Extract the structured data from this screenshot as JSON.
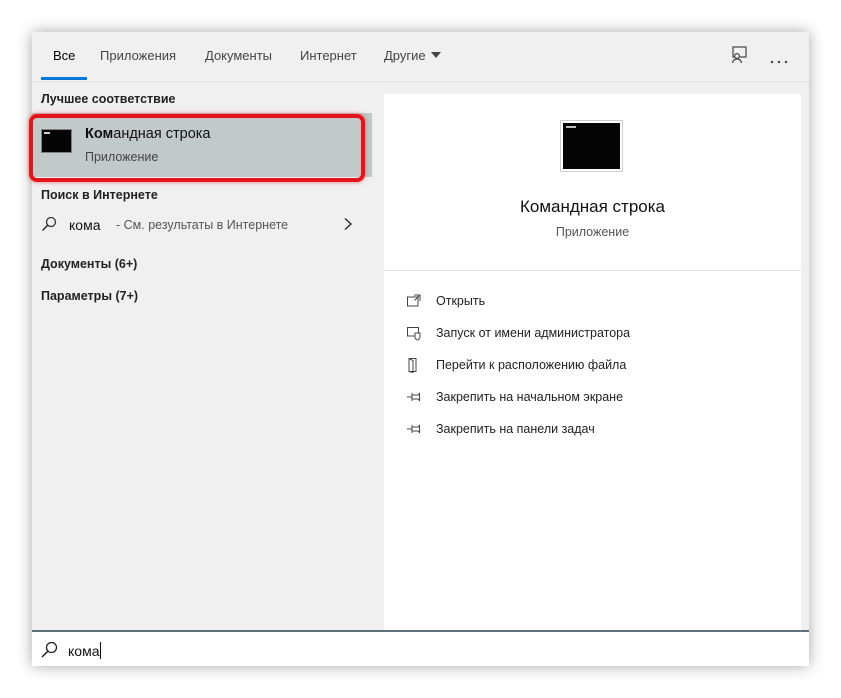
{
  "tabs": [
    {
      "label": "Все"
    },
    {
      "label": "Приложения"
    },
    {
      "label": "Документы"
    },
    {
      "label": "Интернет"
    },
    {
      "label": "Другие"
    }
  ],
  "header_icons": [
    "feedback-icon",
    "more-icon"
  ],
  "left": {
    "best_match_title": "Лучшее соответствие",
    "best_match": {
      "name_bold": "Ком",
      "name_rest": "андная строка",
      "type": "Приложение"
    },
    "web_title": "Поиск в Интернете",
    "web_row": {
      "query": "кома",
      "hint": "- См. результаты в Интернете"
    },
    "documents": "Документы (6+)",
    "settings": "Параметры (7+)"
  },
  "right": {
    "app_name": "Командная строка",
    "app_type": "Приложение",
    "actions": [
      {
        "label": "Открыть",
        "icon": "open-icon"
      },
      {
        "label": "Запуск от имени администратора",
        "icon": "run-as-admin-icon"
      },
      {
        "label": "Перейти к расположению файла",
        "icon": "file-location-icon"
      },
      {
        "label": "Закрепить на начальном экране",
        "icon": "pin-icon"
      },
      {
        "label": "Закрепить на панели задач",
        "icon": "pin-icon"
      }
    ]
  },
  "search": {
    "value": "кома"
  },
  "colors": {
    "accent": "#0078d7",
    "highlight": "#e3141c",
    "selected_bg": "#c2c9c9"
  }
}
